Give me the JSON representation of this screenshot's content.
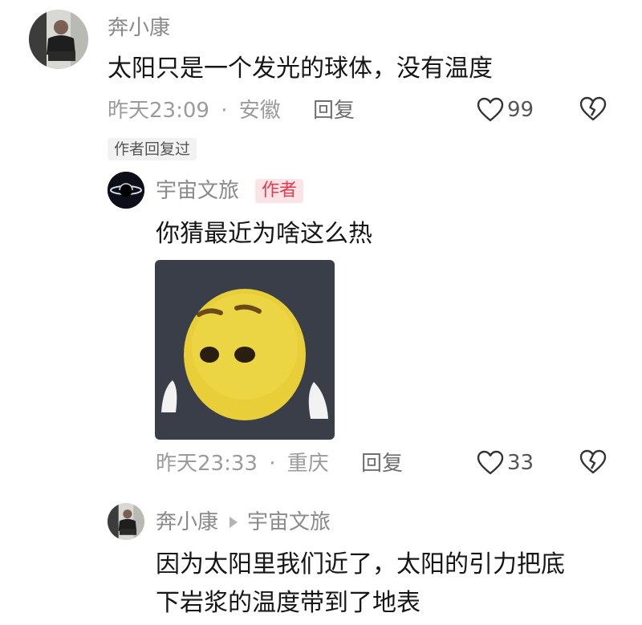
{
  "comment": {
    "author": "奔小康",
    "text": "太阳只是一个发光的球体，没有温度",
    "time": "昨天23:09",
    "separator": "·",
    "location": "安徽",
    "reply_label": "回复",
    "like_count": "99",
    "author_replied_tag": "作者回复过"
  },
  "reply1": {
    "author": "宇宙文旅",
    "badge": "作者",
    "text": "你猜最近为啥这么热",
    "time": "昨天23:33",
    "separator": "·",
    "location": "重庆",
    "reply_label": "回复",
    "like_count": "33"
  },
  "reply2": {
    "author": "奔小康",
    "reply_to": "宇宙文旅",
    "text_line1": "因为太阳里我们近了，太阳的引力把底",
    "text_line2": "下岩浆的温度带到了地表"
  },
  "colors": {
    "badge_bg": "#fbe3e6",
    "badge_text": "#e23a4f",
    "meta_text": "#9b9b9b"
  }
}
